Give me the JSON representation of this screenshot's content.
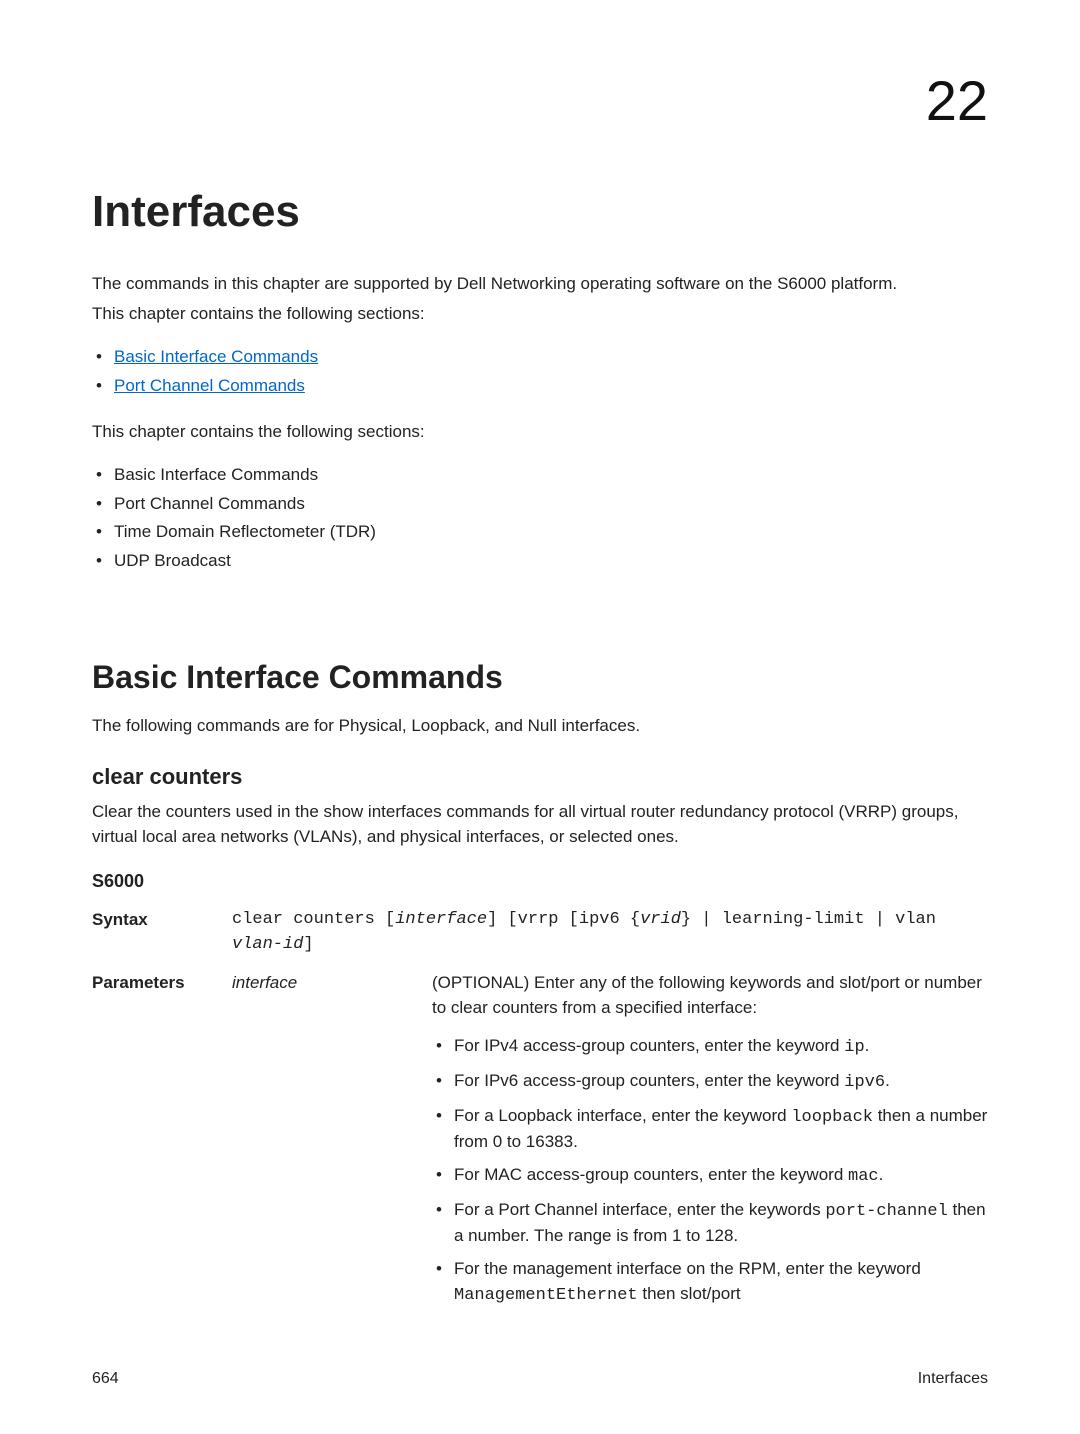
{
  "chapter_number": "22",
  "title": "Interfaces",
  "intro1": "The commands in this chapter are supported by Dell Networking operating software on the S6000 platform.",
  "intro2": "This chapter contains the following sections:",
  "links": [
    "Basic Interface Commands",
    "Port Channel Commands"
  ],
  "intro3": "This chapter contains the following sections:",
  "sections_plain": [
    "Basic Interface Commands",
    "Port Channel Commands",
    "Time Domain Reflectometer (TDR)",
    "UDP Broadcast"
  ],
  "h2": "Basic Interface Commands",
  "h2_desc": "The following commands are for Physical, Loopback, and Null interfaces.",
  "cmd_heading": "clear counters",
  "cmd_desc": "Clear the counters used in the show interfaces commands for all virtual router redundancy protocol (VRRP) groups, virtual local area networks (VLANs), and physical interfaces, or selected ones.",
  "platform": "S6000",
  "syntax_label": "Syntax",
  "syntax_pre": "clear counters [",
  "syntax_italic1": "interface",
  "syntax_mid1": "] [vrrp [ipv6 {",
  "syntax_italic2": "vrid",
  "syntax_mid2": "} | learning-limit | vlan ",
  "syntax_italic3": "vlan-id",
  "syntax_end": "]",
  "params_label": "Parameters",
  "param_name": "interface",
  "param_desc": "(OPTIONAL) Enter any of the following keywords and slot/port or number to clear counters from a specified interface:",
  "param_items": {
    "i0a": "For IPv4 access-group counters, enter the keyword ",
    "i0b": "ip",
    "i0c": ".",
    "i1a": "For IPv6 access-group counters, enter the keyword ",
    "i1b": "ipv6",
    "i1c": ".",
    "i2a": "For a Loopback interface, enter the keyword ",
    "i2b": "loopback",
    "i2c": " then a number from 0 to 16383.",
    "i3a": "For MAC access-group counters, enter the keyword ",
    "i3b": "mac",
    "i3c": ".",
    "i4a": "For a Port Channel interface, enter the keywords ",
    "i4b": "port-channel",
    "i4c": " then a number. The range is from 1 to 128.",
    "i5a": "For the management interface on the RPM, enter the keyword ",
    "i5b": "ManagementEthernet",
    "i5c": " then slot/port"
  },
  "footer_left": "664",
  "footer_right": "Interfaces"
}
